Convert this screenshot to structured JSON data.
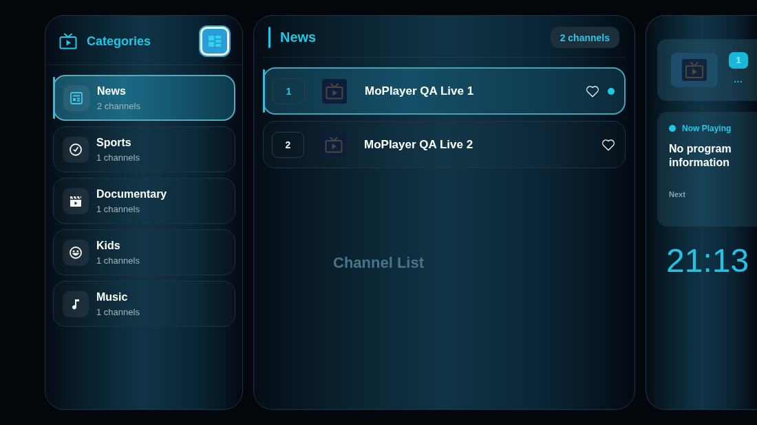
{
  "categories_panel": {
    "title": "Categories",
    "view_button": {
      "focused": true
    },
    "items": [
      {
        "name": "News",
        "count": "2 channels",
        "selected": true
      },
      {
        "name": "Sports",
        "count": "1 channels",
        "selected": false
      },
      {
        "name": "Documentary",
        "count": "1 channels",
        "selected": false
      },
      {
        "name": "Kids",
        "count": "1 channels",
        "selected": false
      },
      {
        "name": "Music",
        "count": "1 channels",
        "selected": false
      }
    ]
  },
  "channel_panel": {
    "title": "News",
    "count_badge": "2 channels",
    "channels": [
      {
        "number": "1",
        "name": "MoPlayer QA Live 1",
        "selected": true,
        "favorite": false,
        "playing": true
      },
      {
        "number": "2",
        "name": "MoPlayer QA Live 2",
        "selected": false,
        "favorite": false,
        "playing": false
      }
    ],
    "overlay": {
      "title": "Channel List"
    }
  },
  "info_panel": {
    "preview": {
      "badge": "1",
      "name": "..."
    },
    "now_playing": {
      "label": "Now Playing",
      "title": "No program information",
      "next_label": "Next"
    },
    "clock": "21:13"
  }
}
